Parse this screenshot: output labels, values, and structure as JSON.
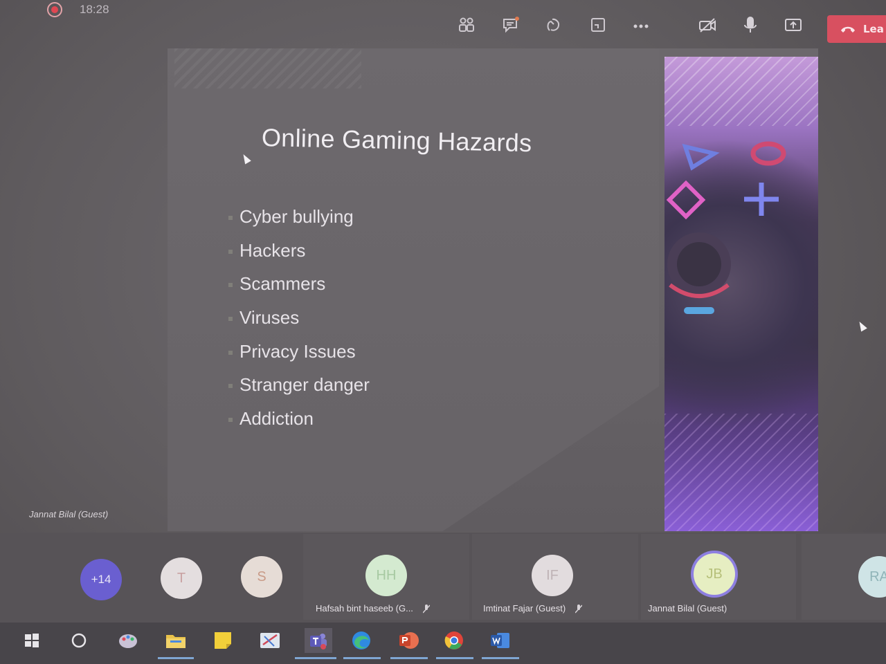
{
  "top_bar": {
    "time": "18:28",
    "buttons": [
      {
        "name": "participants-icon"
      },
      {
        "name": "chat-icon"
      },
      {
        "name": "reactions-icon"
      },
      {
        "name": "share-tray-icon"
      },
      {
        "name": "more-actions-icon"
      },
      {
        "name": "camera-off-icon"
      },
      {
        "name": "microphone-icon"
      },
      {
        "name": "share-screen-icon"
      }
    ],
    "leave_label": "Lea",
    "leave_color": "#d85060"
  },
  "slide": {
    "title": "Online Gaming Hazards",
    "bullets": [
      "Cyber bullying",
      "Hackers",
      "Scammers",
      "Viruses",
      "Privacy Issues",
      "Stranger danger",
      "Addiction"
    ]
  },
  "presenter": {
    "name": "Jannat Bilal (Guest)"
  },
  "participants": [
    {
      "initials": "+14",
      "name": "",
      "color": "#6a5fd0"
    },
    {
      "initials": "T",
      "name": "",
      "color": "#e4dedf"
    },
    {
      "initials": "S",
      "name": "",
      "color": "#e6dcd6"
    },
    {
      "initials": "HH",
      "name": "Hafsah bint haseeb (G...",
      "color": "#d4ead0"
    },
    {
      "initials": "IF",
      "name": "Imtinat Fajar (Guest)",
      "color": "#e2dcde"
    },
    {
      "initials": "JB",
      "name": "Jannat Bilal (Guest)",
      "color": "#e6eec2"
    },
    {
      "initials": "RA",
      "name": "",
      "color": "#cfe4e6"
    }
  ],
  "taskbar": {
    "apps": [
      {
        "name": "windows-start-icon"
      },
      {
        "name": "cortana-search-icon"
      },
      {
        "name": "paint-icon"
      },
      {
        "name": "file-explorer-icon"
      },
      {
        "name": "sticky-notes-icon"
      },
      {
        "name": "snipping-tool-icon"
      },
      {
        "name": "teams-icon"
      },
      {
        "name": "edge-icon"
      },
      {
        "name": "powerpoint-icon"
      },
      {
        "name": "chrome-icon"
      },
      {
        "name": "word-icon"
      }
    ]
  }
}
